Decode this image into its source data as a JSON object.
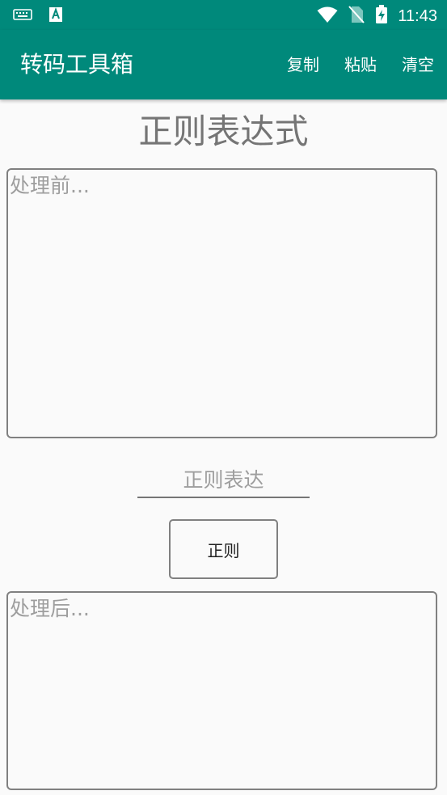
{
  "status_bar": {
    "time": "11:43",
    "icons": [
      "keyboard-icon",
      "font-a-icon",
      "wifi-icon",
      "no-sim-icon",
      "battery-charging-icon"
    ]
  },
  "app_bar": {
    "title": "转码工具箱",
    "menu": {
      "copy": "复制",
      "paste": "粘贴",
      "clear": "清空"
    }
  },
  "main": {
    "page_title": "正则表达式",
    "before_placeholder": "处理前...",
    "regex_placeholder": "正则表达",
    "action_label": "正则",
    "after_placeholder": "处理后..."
  },
  "colors": {
    "primary": "#00897b",
    "background": "#fafafa",
    "border": "#808080",
    "title_text": "#757575",
    "hint_text": "#9e9e9e"
  }
}
